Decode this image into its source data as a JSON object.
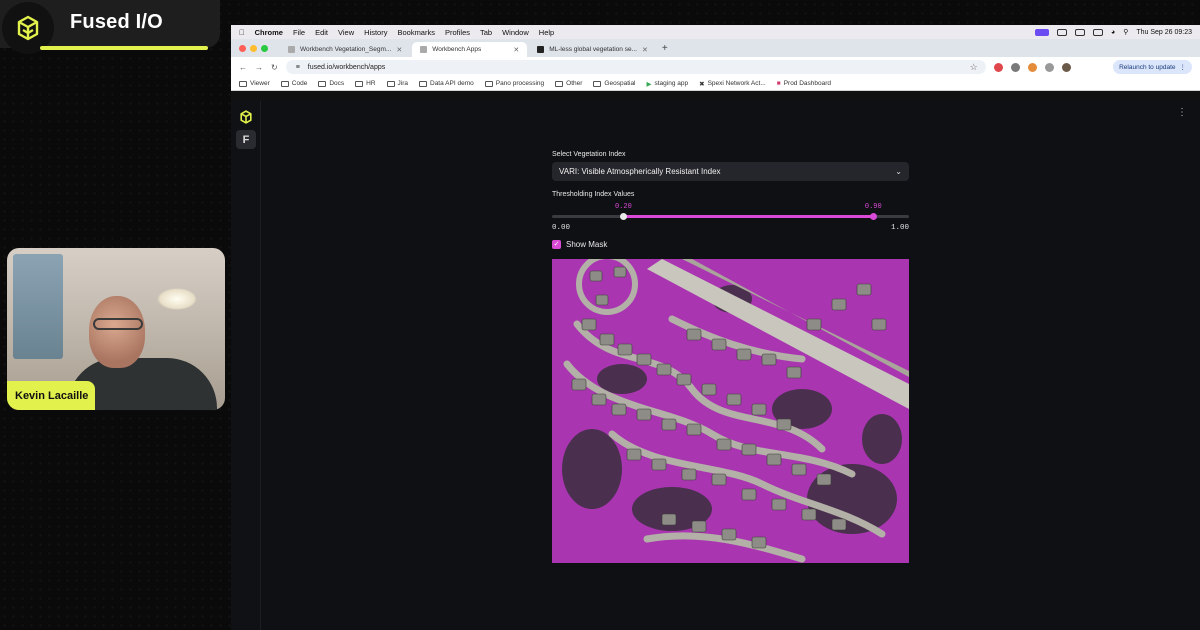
{
  "stream": {
    "brand_title": "Fused I/O",
    "presenter_name": "Kevin Lacaille",
    "accent_color": "#e2f14b"
  },
  "macos_menubar": {
    "items": [
      "Chrome",
      "File",
      "Edit",
      "View",
      "History",
      "Bookmarks",
      "Profiles",
      "Tab",
      "Window",
      "Help"
    ],
    "clock": "Thu Sep 26  09:23"
  },
  "browser": {
    "tabs": [
      {
        "label": "Workbench Vegetation_Segm...",
        "active": false
      },
      {
        "label": "Workbench Apps",
        "active": true
      },
      {
        "label": "ML-less global vegetation se...",
        "active": false
      }
    ],
    "url": "fused.io/workbench/apps",
    "relaunch_label": "Relaunch to update",
    "bookmarks": [
      "Viewer",
      "Code",
      "Docs",
      "HR",
      "Jira",
      "Data API demo",
      "Pano processing",
      "Other",
      "Geospatial",
      "staging app",
      "Spexi Network Act...",
      "Prod Dashboard"
    ]
  },
  "app": {
    "side_button_glyph": "F",
    "vegetation_index": {
      "label": "Select Vegetation Index",
      "selected": "VARI: Visible Atmospherically Resistant Index"
    },
    "threshold": {
      "label": "Thresholding Index Values",
      "min": 0.0,
      "max": 1.0,
      "min_label": "0.00",
      "max_label": "1.00",
      "low": 0.2,
      "high": 0.9,
      "low_label": "0.20",
      "high_label": "0.90"
    },
    "show_mask": {
      "label": "Show Mask",
      "checked": true
    },
    "mask_color": "#d94ad6"
  }
}
